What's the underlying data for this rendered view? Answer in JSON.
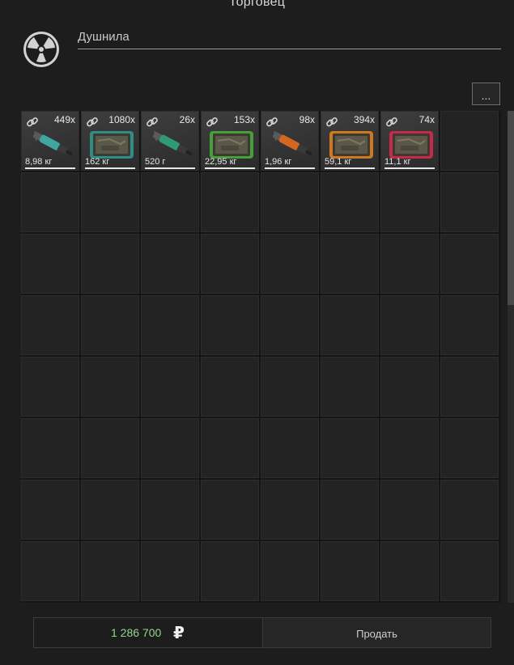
{
  "window": {
    "title": "Торговец"
  },
  "trader": {
    "name": "Душнила"
  },
  "toolbar": {
    "more_label": "..."
  },
  "grid": {
    "columns": 8,
    "rows": 8,
    "items": [
      {
        "count": "449x",
        "weight": "8,98 кг",
        "icon": "syringe-icon",
        "accent": "#3fa6a0"
      },
      {
        "count": "1080x",
        "weight": "162 кг",
        "icon": "device-icon",
        "accent": "#2f8d86"
      },
      {
        "count": "26x",
        "weight": "520 г",
        "icon": "syringe-icon",
        "accent": "#2f9a73"
      },
      {
        "count": "153x",
        "weight": "22,95 кг",
        "icon": "device-icon",
        "accent": "#45a03a"
      },
      {
        "count": "98x",
        "weight": "1,96 кг",
        "icon": "syringe-icon",
        "accent": "#d2671f"
      },
      {
        "count": "394x",
        "weight": "59,1 кг",
        "icon": "device-icon",
        "accent": "#d07722"
      },
      {
        "count": "74x",
        "weight": "11,1 кг",
        "icon": "device-icon",
        "accent": "#c7294a"
      }
    ]
  },
  "footer": {
    "price": "1 286 700",
    "currency_symbol": "₽",
    "sell_label": "Продать"
  },
  "colors": {
    "price": "#8fd88f",
    "background": "#1d1d1d"
  }
}
